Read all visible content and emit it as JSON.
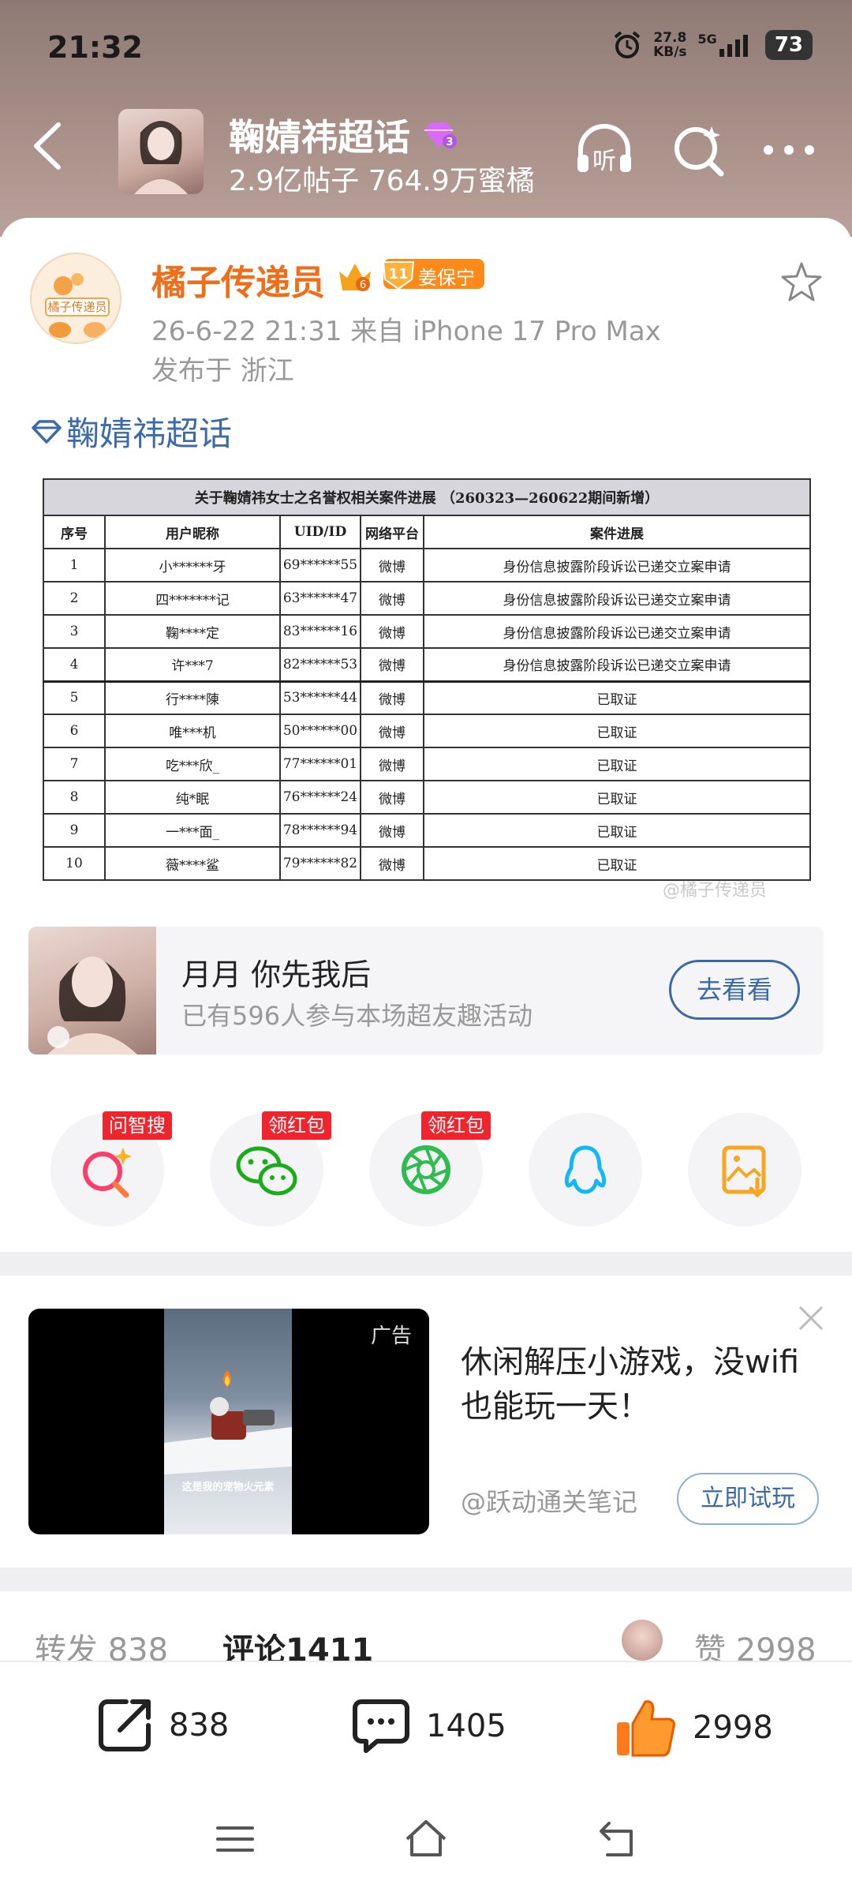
{
  "status_bar": {
    "time": "21:32",
    "net_speed_value": "27.8",
    "net_speed_unit": "KB/s",
    "network": "5G",
    "battery": "73"
  },
  "header": {
    "topic_title": "鞠婧祎超话",
    "topic_level": "3",
    "topic_stats": "2.9亿帖子 764.9万蜜橘",
    "icons": [
      "back-icon",
      "listen-icon",
      "search-icon",
      "more-icon"
    ],
    "listen_label": "听"
  },
  "post": {
    "author": "橘子传递员",
    "author_avatar_text": "橘子传递员",
    "vip_level": "6",
    "fan_badge_level": "11",
    "fan_badge_label": "姜保宁",
    "meta": "26-6-22 21:31   来自 iPhone 17 Pro Max",
    "location": "发布于 浙江",
    "topic_link": "鞠婧祎超话",
    "image_watermark": "@橘子传递员"
  },
  "doc_table": {
    "title": "关于鞠婧祎女士之名誉权相关案件进展 （260323—260622期间新增）",
    "columns": [
      "序号",
      "用户昵称",
      "UID/ID",
      "网络平台",
      "案件进展"
    ],
    "rows": [
      [
        "1",
        "小******牙",
        "69******55",
        "微博",
        "身份信息披露阶段诉讼已递交立案申请"
      ],
      [
        "2",
        "四*******记",
        "63******47",
        "微博",
        "身份信息披露阶段诉讼已递交立案申请"
      ],
      [
        "3",
        "鞠****定",
        "83******16",
        "微博",
        "身份信息披露阶段诉讼已递交立案申请"
      ],
      [
        "4",
        "许***7",
        "82******53",
        "微博",
        "身份信息披露阶段诉讼已递交立案申请"
      ],
      [
        "5",
        "行****陳",
        "53******44",
        "微博",
        "已取证"
      ],
      [
        "6",
        "唯***机",
        "50******00",
        "微博",
        "已取证"
      ],
      [
        "7",
        "吃***欣_",
        "77******01",
        "微博",
        "已取证"
      ],
      [
        "8",
        "纯*眠",
        "76******24",
        "微博",
        "已取证"
      ],
      [
        "9",
        "一***面_",
        "78******94",
        "微博",
        "已取证"
      ],
      [
        "10",
        "薇****鲨",
        "79******82",
        "微博",
        "已取证"
      ]
    ]
  },
  "activity": {
    "title": "月月 你先我后",
    "subtitle": "已有596人参与本场超友趣活动",
    "button": "去看看"
  },
  "share": {
    "items": [
      {
        "icon": "ai-search-icon",
        "tag": "问智搜",
        "color": "#ff3d6b"
      },
      {
        "icon": "wechat-icon",
        "tag": "领红包",
        "color": "#1aad19"
      },
      {
        "icon": "moments-icon",
        "tag": "领红包",
        "color": "#2ebc4f"
      },
      {
        "icon": "qq-icon",
        "tag": "",
        "color": "#12b7f5"
      },
      {
        "icon": "save-image-icon",
        "tag": "",
        "color": "#f5a623"
      }
    ]
  },
  "ad": {
    "label": "广告",
    "title": "休闲解压小游戏，没wifi也能玩一天！",
    "author": "@跃动通关笔记",
    "button": "立即试玩",
    "video_caption": "这是我的宠物火元素"
  },
  "tabs": {
    "repost_label": "转发",
    "repost_count": "838",
    "comment_label": "评论",
    "comment_count": "1411",
    "like_label": "赞",
    "like_count": "2998"
  },
  "actions": {
    "repost": "838",
    "comment": "1405",
    "like": "2998"
  },
  "colors": {
    "accent_orange": "#f06d1a",
    "link_blue": "#3d6aa8",
    "like_orange": "#ff7a1a"
  }
}
